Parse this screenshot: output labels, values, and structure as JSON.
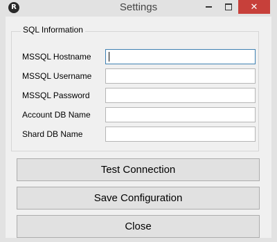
{
  "window": {
    "title": "Settings",
    "app_icon_letter": "R",
    "close_glyph": "✕"
  },
  "sql_group": {
    "legend": "SQL Information",
    "fields": [
      {
        "label": "MSSQL Hostname",
        "value": "",
        "focused": true
      },
      {
        "label": "MSSQL Username",
        "value": ""
      },
      {
        "label": "MSSQL Password",
        "value": ""
      },
      {
        "label": "Account DB Name",
        "value": ""
      },
      {
        "label": "Shard DB Name",
        "value": ""
      }
    ]
  },
  "buttons": {
    "test_connection": "Test Connection",
    "save_configuration": "Save Configuration",
    "close": "Close"
  },
  "colors": {
    "close_button_bg": "#c7403a",
    "focus_border": "#3c7fb1",
    "client_bg": "#f0f0f0"
  }
}
